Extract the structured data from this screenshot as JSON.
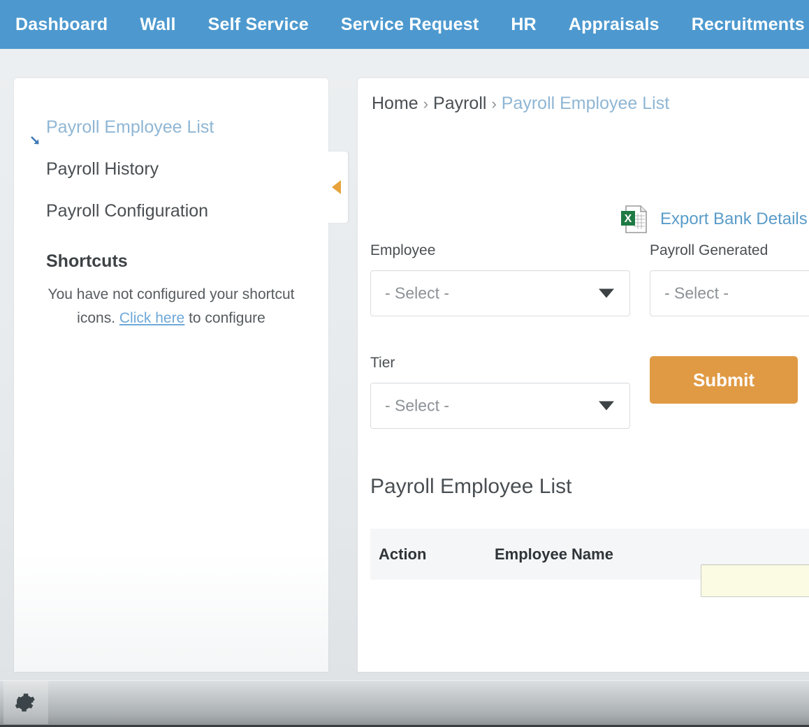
{
  "topnav": {
    "items": [
      {
        "label": "Dashboard"
      },
      {
        "label": "Wall"
      },
      {
        "label": "Self Service"
      },
      {
        "label": "Service Request"
      },
      {
        "label": "HR"
      },
      {
        "label": "Appraisals"
      },
      {
        "label": "Recruitments"
      }
    ],
    "background_color": "#4d99cf",
    "text_color": "#ffffff"
  },
  "sidebar": {
    "items": [
      {
        "label": "Payroll Employee List",
        "active": true,
        "icon": "arrow-down-right-icon"
      },
      {
        "label": "Payroll History",
        "active": false
      },
      {
        "label": "Payroll Configuration",
        "active": false
      }
    ],
    "shortcuts": {
      "title": "Shortcuts",
      "message_before_link": "You have not configured your shortcut icons. ",
      "link_label": "Click here",
      "message_after_link": " to configure"
    },
    "collapse_handle": {
      "icon": "triangle-left-icon",
      "color": "#e8a33d"
    },
    "active_color": "#8fb6d4"
  },
  "main": {
    "breadcrumb": {
      "separator": "›",
      "items": [
        {
          "label": "Home",
          "current": false
        },
        {
          "label": "Payroll",
          "current": false
        },
        {
          "label": "Payroll Employee List",
          "current": true
        }
      ]
    },
    "export": {
      "icon": "excel-file-icon",
      "label": "Export Bank Details",
      "color": "#5a9cc9"
    },
    "form": {
      "employee": {
        "label": "Employee",
        "value": "- Select -",
        "caret_icon": "chevron-down-icon"
      },
      "payroll_generated": {
        "label": "Payroll Generated",
        "value": "- Select -"
      },
      "tier": {
        "label": "Tier",
        "value": "- Select -",
        "caret_icon": "chevron-down-icon"
      },
      "submit_label": "Submit",
      "submit_color": "#e09a44"
    },
    "section_title": "Payroll Employee List",
    "table": {
      "columns": [
        "Action",
        "Employee Name"
      ],
      "rows": []
    },
    "filter_input": {
      "value": "",
      "placeholder": "",
      "background_color": "#fbfbe4"
    }
  },
  "bottombar": {
    "gear_icon": "gear-icon"
  }
}
